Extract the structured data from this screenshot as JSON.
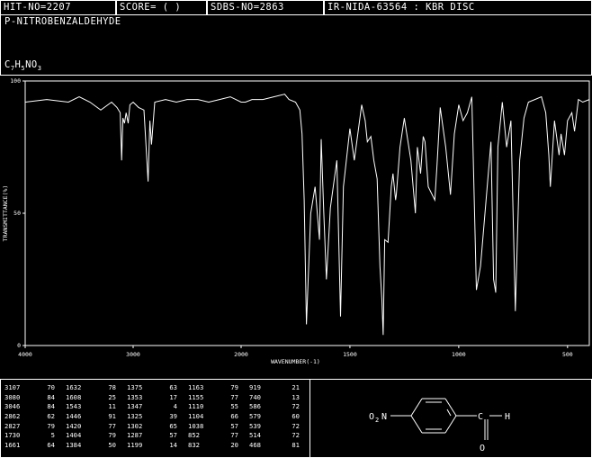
{
  "header": {
    "hit_no": "HIT-NO=2207",
    "score": "SCORE=  (  )",
    "sdbs_no": "SDBS-NO=2863",
    "ir_code": "IR-NIDA-63564 : KBR DISC"
  },
  "compound": {
    "name": "P-NITROBENZALDEHYDE",
    "formula_main": "C",
    "formula_sub1": "7",
    "formula_mid": "H",
    "formula_sub2": "5",
    "formula_end": "NO",
    "formula_sub3": "3"
  },
  "chart_data": {
    "type": "line",
    "xlabel": "WAVENUMBER(-1)",
    "ylabel": "TRANSMITTANCE(%)",
    "xlim": [
      4000,
      400
    ],
    "ylim": [
      0,
      100
    ],
    "x_ticks": [
      "4000",
      "3000",
      "2000",
      "1500",
      "1000",
      "500"
    ],
    "y_ticks": [
      "100",
      "50",
      "0"
    ],
    "series": [
      {
        "x": [
          4000,
          3800,
          3600,
          3500,
          3400,
          3300,
          3200,
          3150,
          3120,
          3107,
          3095,
          3080,
          3065,
          3046,
          3030,
          3000,
          2950,
          2900,
          2880,
          2862,
          2845,
          2830,
          2800,
          2700,
          2600,
          2500,
          2400,
          2300,
          2200,
          2100,
          2000,
          1980,
          1950,
          1900,
          1850,
          1800,
          1780,
          1750,
          1730,
          1720,
          1710,
          1700,
          1680,
          1660,
          1640,
          1632,
          1620,
          1608,
          1590,
          1560,
          1543,
          1530,
          1500,
          1480,
          1446,
          1430,
          1420,
          1404,
          1390,
          1375,
          1362,
          1353,
          1347,
          1340,
          1325,
          1310,
          1302,
          1290,
          1287,
          1270,
          1250,
          1220,
          1199,
          1190,
          1175,
          1163,
          1155,
          1140,
          1110,
          1100,
          1085,
          1060,
          1038,
          1020,
          1000,
          980,
          960,
          940,
          919,
          900,
          852,
          840,
          830,
          820,
          800,
          780,
          760,
          740,
          720,
          700,
          680,
          650,
          620,
          600,
          586,
          579,
          560,
          539,
          530,
          514,
          500,
          480,
          468,
          450,
          430,
          400
        ],
        "y": [
          92,
          93,
          92,
          94,
          92,
          89,
          92,
          90,
          88,
          70,
          86,
          84,
          88,
          84,
          91,
          92,
          90,
          89,
          75,
          62,
          85,
          76,
          92,
          93,
          92,
          93,
          93,
          92,
          93,
          94,
          92,
          92,
          93,
          93,
          94,
          95,
          93,
          92,
          89,
          80,
          55,
          8,
          50,
          60,
          40,
          78,
          50,
          25,
          52,
          70,
          11,
          60,
          82,
          70,
          91,
          85,
          77,
          79,
          70,
          63,
          30,
          17,
          4,
          40,
          39,
          60,
          65,
          55,
          57,
          75,
          86,
          70,
          50,
          75,
          65,
          79,
          77,
          60,
          55,
          68,
          90,
          75,
          57,
          80,
          91,
          85,
          88,
          94,
          21,
          30,
          77,
          25,
          20,
          75,
          92,
          75,
          85,
          13,
          70,
          86,
          92,
          93,
          94,
          88,
          72,
          60,
          85,
          72,
          80,
          72,
          85,
          88,
          81,
          93,
          92,
          93
        ]
      }
    ]
  },
  "peaks": [
    [
      [
        "3107",
        "70"
      ],
      [
        "3080",
        "84"
      ],
      [
        "3046",
        "84"
      ],
      [
        "2862",
        "62"
      ],
      [
        "2827",
        "79"
      ],
      [
        "1730",
        "5"
      ],
      [
        "1661",
        "64"
      ]
    ],
    [
      [
        "1632",
        "78"
      ],
      [
        "1608",
        "25"
      ],
      [
        "1543",
        "11"
      ],
      [
        "1446",
        "91"
      ],
      [
        "1420",
        "77"
      ],
      [
        "1404",
        "79"
      ],
      [
        "1384",
        "50"
      ]
    ],
    [
      [
        "1375",
        "63"
      ],
      [
        "1353",
        "17"
      ],
      [
        "1347",
        "4"
      ],
      [
        "1325",
        "39"
      ],
      [
        "1302",
        "65"
      ],
      [
        "1287",
        "57"
      ],
      [
        "1199",
        "14"
      ]
    ],
    [
      [
        "1163",
        "79"
      ],
      [
        "1155",
        "77"
      ],
      [
        "1110",
        "55"
      ],
      [
        "1104",
        "66"
      ],
      [
        "1038",
        "57"
      ],
      [
        "852",
        "77"
      ],
      [
        "832",
        "20"
      ]
    ],
    [
      [
        "919",
        "21"
      ],
      [
        "740",
        "13"
      ],
      [
        "586",
        "72"
      ],
      [
        "579",
        "60"
      ],
      [
        "539",
        "72"
      ],
      [
        "514",
        "72"
      ],
      [
        "468",
        "81"
      ]
    ]
  ],
  "structure": {
    "left_group": "O",
    "left_sub": "2",
    "left_n": "N",
    "carbon": "C",
    "hydrogen": "H",
    "oxygen": "O"
  },
  "colors": {
    "background": "#000000",
    "foreground": "#ffffff"
  }
}
